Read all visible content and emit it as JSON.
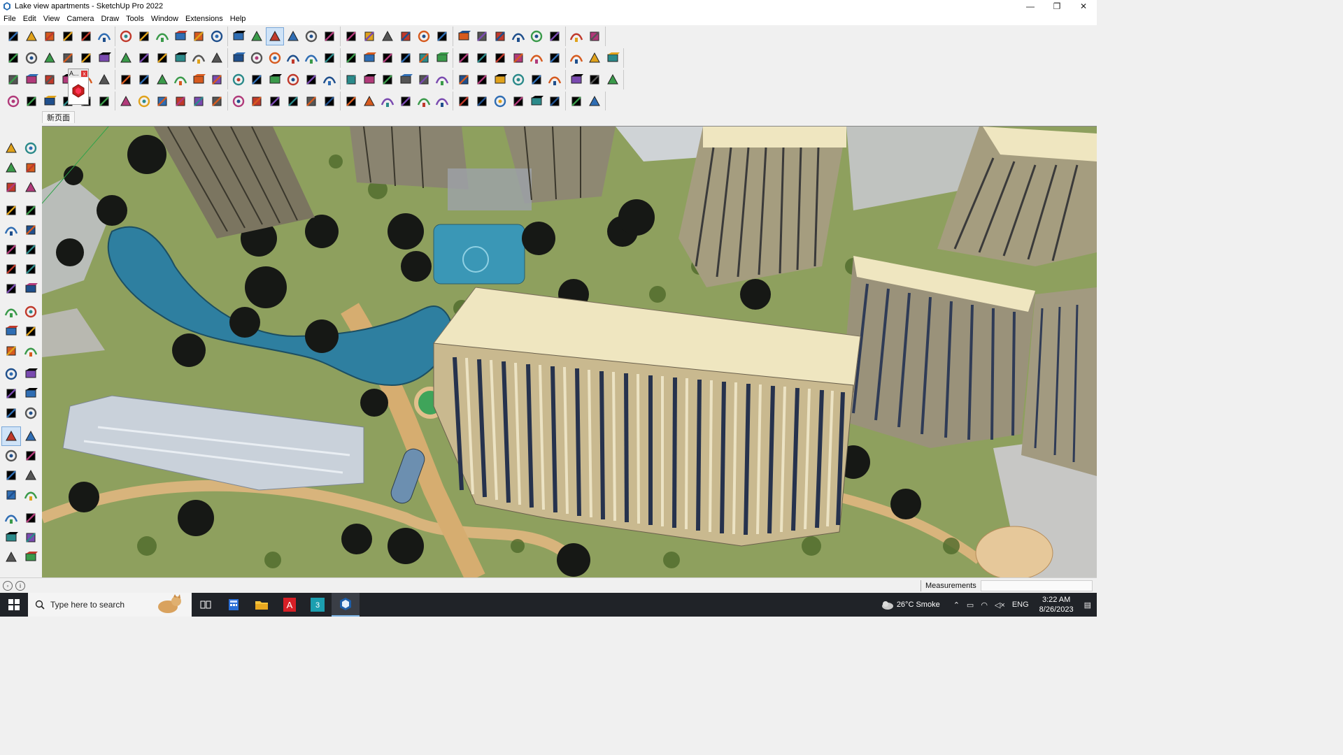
{
  "window": {
    "title": "Lake view apartments - SketchUp Pro 2022",
    "minimize_glyph": "—",
    "maximize_glyph": "❐",
    "close_glyph": "✕"
  },
  "menu": {
    "items": [
      "File",
      "Edit",
      "View",
      "Camera",
      "Draw",
      "Tools",
      "Window",
      "Extensions",
      "Help"
    ]
  },
  "scene_tabs": [
    {
      "label": "新页面"
    }
  ],
  "toolbar": {
    "floating_panel_label": "A...",
    "row1_icons": [
      "zoom-extents-icon",
      "select-icon",
      "eraser-icon",
      "line-icon",
      "arc-icon",
      "rectangle-icon",
      "push-pull-icon",
      "follow-me-icon",
      "move-icon",
      "rotate-icon",
      "scale-icon",
      "tape-measure-icon",
      "text-icon",
      "paint-bucket-icon",
      "orbit-icon",
      "pan-icon",
      "zoom-icon",
      "zoom-window-icon",
      "section-plane-icon",
      "display-section-icon",
      "section-fill-icon",
      "section-cuts-icon",
      "user-account-icon",
      "warehouse-icon",
      "extension-warehouse-icon",
      "layout-icon",
      "solid-tools-icon",
      "sandbox-icon",
      "flip-icon",
      "undo-icon",
      "redo-icon",
      "component-icon"
    ],
    "row2_icons": [
      "box-icon",
      "3d-text-icon",
      "solid-icon",
      "axes-red-icon",
      "push-pull-multi-icon",
      "dimension-icon",
      "style-icon",
      "sketch-style-icon",
      "xray-icon",
      "wireframe-icon",
      "hidden-line-icon",
      "shaded-icon",
      "textured-icon",
      "monochrome-icon",
      "iso-view-icon",
      "top-view-icon",
      "front-view-icon",
      "right-view-icon",
      "back-view-icon",
      "left-view-icon",
      "fillet-icon",
      "pencil-icon",
      "curve-tools-icon",
      "loft-icon",
      "circle-icon",
      "polygon-icon",
      "ellipse-icon",
      "parallelogram-icon",
      "bezier-icon",
      "spiral-icon",
      "torus-icon",
      "shape-bender-icon",
      "chamfer-icon"
    ],
    "row3_icons": [
      "plane-blue-icon",
      "plane-cyan-icon",
      "plane-yellow-icon",
      "outliner-icon",
      "group-icon",
      "component-red-icon",
      "layer-icon",
      "curve-icon",
      "bend-icon",
      "offset-icon",
      "spline-icon",
      "extrude-icon",
      "cross-icon",
      "intersect-icon",
      "cone-icon",
      "pyramid-icon",
      "warning-icon",
      "arc-tool-icon",
      "lathe-icon",
      "weld-icon",
      "explode-icon",
      "joint-push-pull-icon",
      "round-corner-icon",
      "shell-icon",
      "solid-inspector-icon",
      "vertex-tools-icon",
      "split-icon",
      "grid-icon",
      "grid-yellow-icon",
      "grid-orange-icon",
      "dots-icon",
      "circle-dots-icon",
      "nodes-icon"
    ],
    "row4_icons": [
      "draw-curve-icon",
      "path-icon",
      "truck-icon",
      "arch-icon",
      "folding-icon",
      "twist-icon",
      "unfold-icon",
      "hexagon-icon",
      "sphere-icon",
      "helix-icon",
      "line-segment-icon",
      "angle-icon",
      "slice-icon",
      "tilt-icon",
      "skew-icon",
      "stairs-icon",
      "bridge-icon",
      "comb-icon",
      "rib-icon",
      "fan-icon",
      "leaf-icon",
      "curtain-icon",
      "wave-icon",
      "sweep-icon",
      "stripes-icon",
      "fence-icon",
      "columns-icon",
      "pattern-icon",
      "roof-icon",
      "terrain-icon",
      "mesh-icon",
      "net-icon"
    ]
  },
  "left_palette": {
    "icons": [
      "select-icon",
      "orbit-multi-icon",
      "paint-bucket-icon",
      "eraser-icon",
      "tag-icon",
      "pencil-tool-icon",
      "line-icon",
      "freehand-icon",
      "rectangle-icon",
      "rotated-rectangle-icon",
      "circle-icon",
      "polygon-icon",
      "arc-icon",
      "2-point-arc-icon",
      "pie-icon",
      "3-point-arc-icon",
      "move-icon",
      "push-pull-icon",
      "rotate-icon",
      "follow-me-icon",
      "scale-icon",
      "offset-icon",
      "tape-measure-icon",
      "dimension-icon",
      "protractor-icon",
      "text-icon",
      "axes-icon",
      "3d-text-icon",
      "orbit-icon",
      "pan-icon",
      "zoom-icon",
      "zoom-window-icon",
      "zoom-extents-icon",
      "previous-view-icon",
      "position-camera-icon",
      "look-around-icon",
      "walk-icon",
      "section-plane-icon",
      "section-display-icon",
      "section-cut-icon",
      "section-fill-icon",
      "section-plane-2-icon"
    ]
  },
  "status": {
    "measurements_label": "Measurements",
    "measurements_value": ""
  },
  "taskbar": {
    "search_placeholder": "Type here to search",
    "weather": "26°C  Smoke",
    "lang": "ENG",
    "time": "3:22 AM",
    "date": "8/26/2023",
    "apps": [
      "task-view-icon",
      "calculator-icon",
      "file-explorer-icon",
      "acrobat-icon",
      "3dsmax-icon",
      "sketchup-icon"
    ]
  },
  "colors": {
    "grass": "#8aa05a",
    "building_roof": "#efe6c0",
    "building_facade": "#c8b58a",
    "water": "#2b7a9a",
    "tree": "#1a1a1a",
    "path": "#d6b07a"
  }
}
